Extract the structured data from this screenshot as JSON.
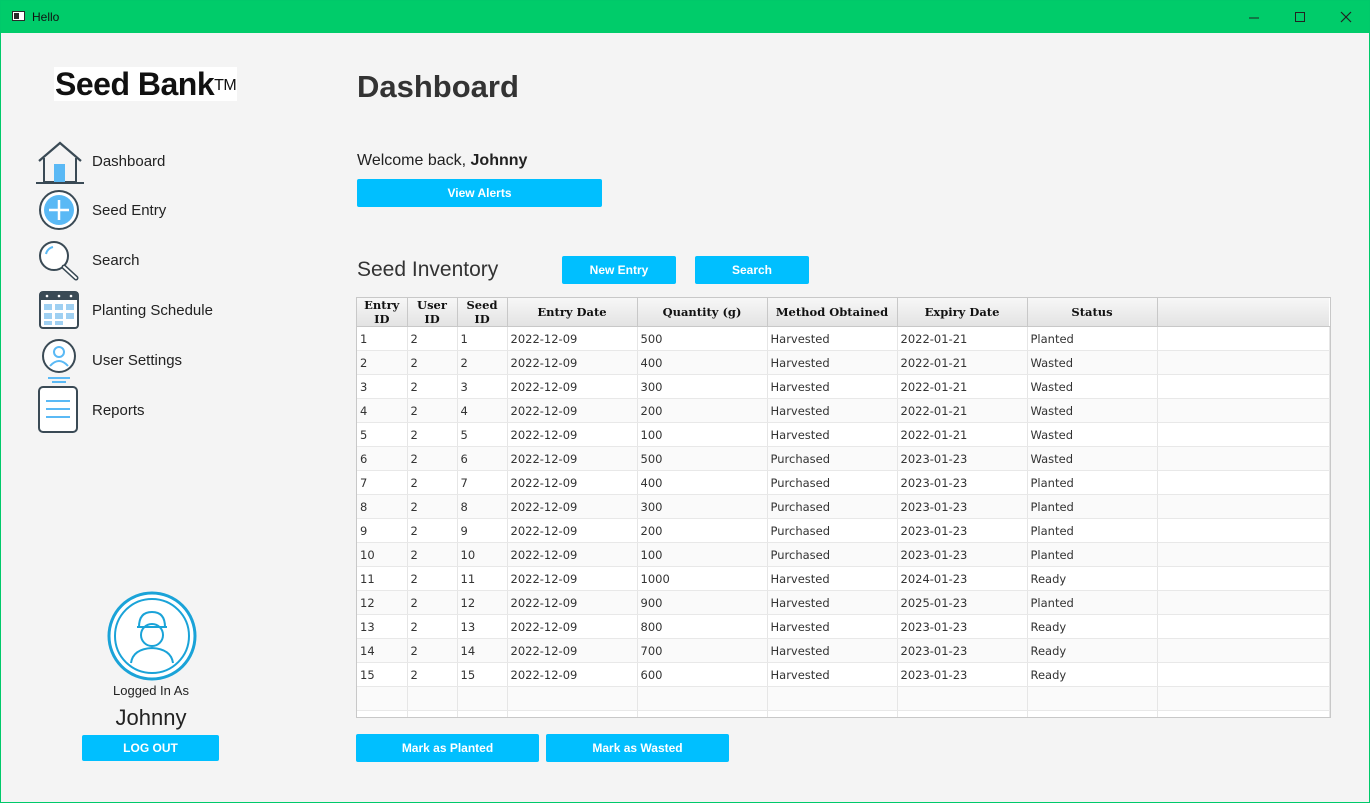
{
  "window": {
    "title": "Hello"
  },
  "brand": {
    "name": "Seed Bank",
    "mark": "TM"
  },
  "sidebar": {
    "items": [
      {
        "label": "Dashboard",
        "icon": "house-icon"
      },
      {
        "label": "Seed Entry",
        "icon": "plus-circle-icon"
      },
      {
        "label": "Search",
        "icon": "magnifier-icon"
      },
      {
        "label": "Planting Schedule",
        "icon": "calendar-icon"
      },
      {
        "label": "User Settings",
        "icon": "user-icon"
      },
      {
        "label": "Reports",
        "icon": "document-icon"
      }
    ],
    "logged_in_label": "Logged In As",
    "user_name": "Johnny",
    "logout_label": "LOG OUT"
  },
  "main": {
    "title": "Dashboard",
    "welcome_prefix": "Welcome back,",
    "welcome_name": "Johnny",
    "view_alerts_label": "View Alerts",
    "inventory_title": "Seed Inventory",
    "new_entry_label": "New Entry",
    "search_label": "Search",
    "mark_planted_label": "Mark as Planted",
    "mark_wasted_label": "Mark as Wasted"
  },
  "table": {
    "columns": [
      "Entry ID",
      "User ID",
      "Seed ID",
      "Entry Date",
      "Quantity (g)",
      "Method Obtained",
      "Expiry Date",
      "Status"
    ],
    "rows": [
      [
        "1",
        "2",
        "1",
        "2022-12-09",
        "500",
        "Harvested",
        "2022-01-21",
        "Planted"
      ],
      [
        "2",
        "2",
        "2",
        "2022-12-09",
        "400",
        "Harvested",
        "2022-01-21",
        "Wasted"
      ],
      [
        "3",
        "2",
        "3",
        "2022-12-09",
        "300",
        "Harvested",
        "2022-01-21",
        "Wasted"
      ],
      [
        "4",
        "2",
        "4",
        "2022-12-09",
        "200",
        "Harvested",
        "2022-01-21",
        "Wasted"
      ],
      [
        "5",
        "2",
        "5",
        "2022-12-09",
        "100",
        "Harvested",
        "2022-01-21",
        "Wasted"
      ],
      [
        "6",
        "2",
        "6",
        "2022-12-09",
        "500",
        "Purchased",
        "2023-01-23",
        "Wasted"
      ],
      [
        "7",
        "2",
        "7",
        "2022-12-09",
        "400",
        "Purchased",
        "2023-01-23",
        "Planted"
      ],
      [
        "8",
        "2",
        "8",
        "2022-12-09",
        "300",
        "Purchased",
        "2023-01-23",
        "Planted"
      ],
      [
        "9",
        "2",
        "9",
        "2022-12-09",
        "200",
        "Purchased",
        "2023-01-23",
        "Planted"
      ],
      [
        "10",
        "2",
        "10",
        "2022-12-09",
        "100",
        "Purchased",
        "2023-01-23",
        "Planted"
      ],
      [
        "11",
        "2",
        "11",
        "2022-12-09",
        "1000",
        "Harvested",
        "2024-01-23",
        "Ready"
      ],
      [
        "12",
        "2",
        "12",
        "2022-12-09",
        "900",
        "Harvested",
        "2025-01-23",
        "Planted"
      ],
      [
        "13",
        "2",
        "13",
        "2022-12-09",
        "800",
        "Harvested",
        "2023-01-23",
        "Ready"
      ],
      [
        "14",
        "2",
        "14",
        "2022-12-09",
        "700",
        "Harvested",
        "2023-01-23",
        "Ready"
      ],
      [
        "15",
        "2",
        "15",
        "2022-12-09",
        "600",
        "Harvested",
        "2023-01-23",
        "Ready"
      ]
    ]
  },
  "colors": {
    "titlebar": "#00cc6a",
    "accent": "#00bfff",
    "icon_blue": "#5ab9f5",
    "icon_dark": "#3a4a55"
  }
}
